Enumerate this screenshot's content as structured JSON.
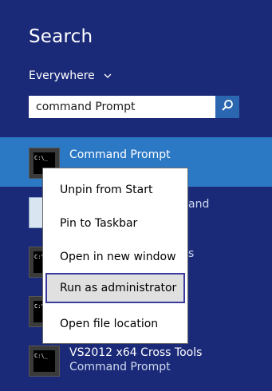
{
  "panel": {
    "title": "Search",
    "scope": "Everywhere"
  },
  "search": {
    "value": "command Prompt"
  },
  "results": [
    {
      "line1": "Command Prompt",
      "line2": ""
    },
    {
      "line1": "and",
      "line2": ""
    },
    {
      "line1": "s",
      "line2": ""
    },
    {
      "line1": "",
      "line2": ""
    },
    {
      "line1": "VS2012 x64 Cross Tools",
      "line2": "Command Prompt"
    }
  ],
  "context_menu": {
    "items": [
      "Unpin from Start",
      "Pin to Taskbar",
      "Open in new window",
      "Run as administrator",
      "Open file location"
    ],
    "highlighted_index": 3
  },
  "icon_names": {
    "scope": "chevron-down-icon",
    "search": "search-icon",
    "console": "command-prompt-icon"
  },
  "colors": {
    "background": "#1b2a78",
    "selected_row": "#2b78c5",
    "search_button": "#2b66b0",
    "menu_highlight_border": "#3c3ca0"
  }
}
